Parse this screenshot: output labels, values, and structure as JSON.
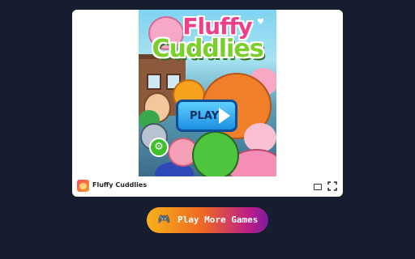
{
  "game": {
    "title_line1": "Fluffy",
    "title_line2": "Cuddlies",
    "play_label": "PLAY",
    "settings_icon": "gear-icon"
  },
  "info_bar": {
    "game_name": "Fluffy Cuddlies",
    "theater_icon": "theater-mode-icon",
    "fullscreen_icon": "fullscreen-icon"
  },
  "cta": {
    "icon": "gamepad-icon",
    "label": "Play More Games"
  },
  "colors": {
    "page_background": "#151d2e",
    "card_background": "#ffffff",
    "cta_gradient_start": "#f7b21b",
    "cta_gradient_end": "#7d1b9e",
    "play_button": "#1e8fe0"
  }
}
